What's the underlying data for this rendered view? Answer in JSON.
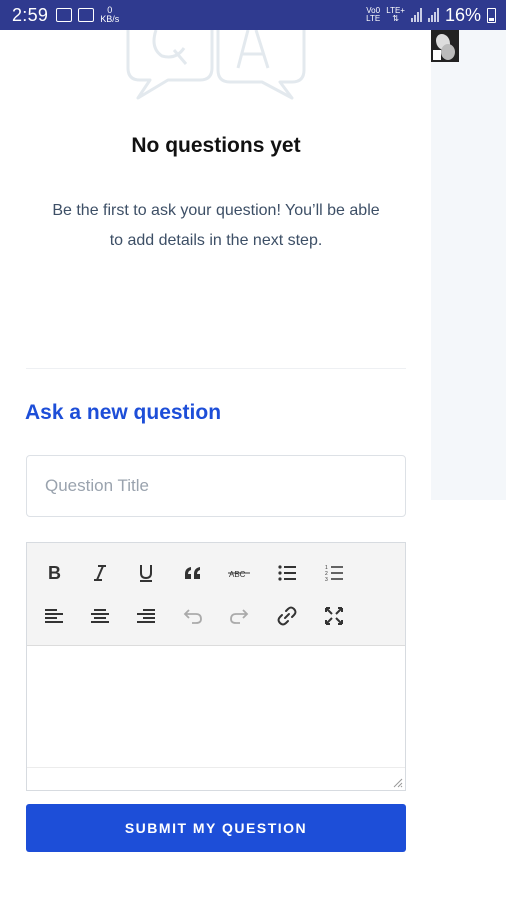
{
  "status_bar": {
    "time": "2:59",
    "data_speed_value": "0",
    "data_speed_unit": "KB/s",
    "network_label_top": "Vo0",
    "network_label_bottom": "LTE",
    "lte_label": "LTE+",
    "battery": "16%"
  },
  "empty_state": {
    "title": "No questions yet",
    "description": "Be the first to ask your question! You’ll be able to add details in the next step."
  },
  "form": {
    "heading": "Ask a new question",
    "title_placeholder": "Question Title",
    "title_value": "",
    "toolbar": [
      {
        "name": "bold-icon"
      },
      {
        "name": "italic-icon"
      },
      {
        "name": "underline-icon"
      },
      {
        "name": "quote-icon"
      },
      {
        "name": "strikethrough-icon"
      },
      {
        "name": "bulleted-list-icon"
      },
      {
        "name": "numbered-list-icon"
      },
      {
        "name": "align-left-icon"
      },
      {
        "name": "align-center-icon"
      },
      {
        "name": "align-right-icon"
      },
      {
        "name": "undo-icon"
      },
      {
        "name": "redo-icon"
      },
      {
        "name": "link-icon"
      },
      {
        "name": "fullscreen-icon"
      }
    ],
    "submit_label": "SUBMIT MY QUESTION"
  },
  "colors": {
    "status_bar": "#2f3a8f",
    "accent": "#1d4ed8",
    "side_panel": "#f4f7fa"
  }
}
